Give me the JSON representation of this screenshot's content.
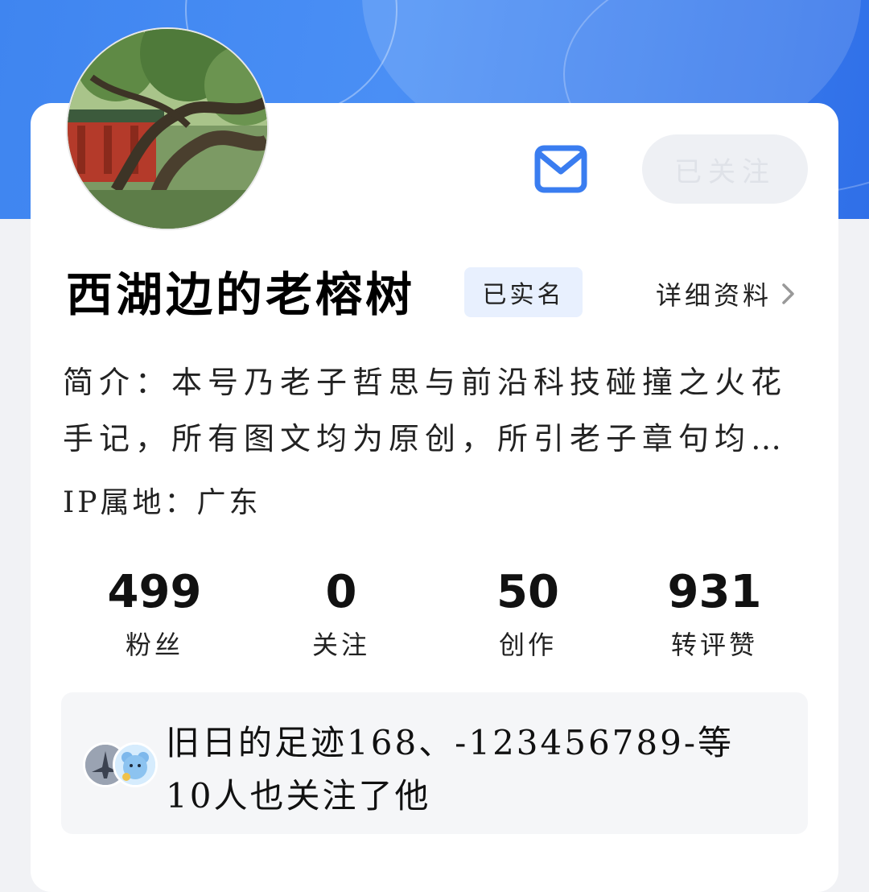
{
  "profile": {
    "name": "西湖边的老榕树",
    "verified_badge": "已实名",
    "detail_link": "详细资料",
    "bio": "简介：本号乃老子哲思与前沿科技碰撞之火花手记，所有图文均为原创，所引老子章句均出自…",
    "ip_location": "IP属地：广东",
    "follow_button": "已关注",
    "message_icon": "mail-icon"
  },
  "stats": [
    {
      "value": "499",
      "label": "粉丝"
    },
    {
      "value": "0",
      "label": "关注"
    },
    {
      "value": "50",
      "label": "创作"
    },
    {
      "value": "931",
      "label": "转评赞"
    }
  ],
  "mutual": {
    "text": "旧日的足迹168、-123456789-等10人也关注了他"
  },
  "colors": {
    "accent": "#3a7df0",
    "banner": "#4a8ff5",
    "badge_bg": "#e8f0fe"
  }
}
